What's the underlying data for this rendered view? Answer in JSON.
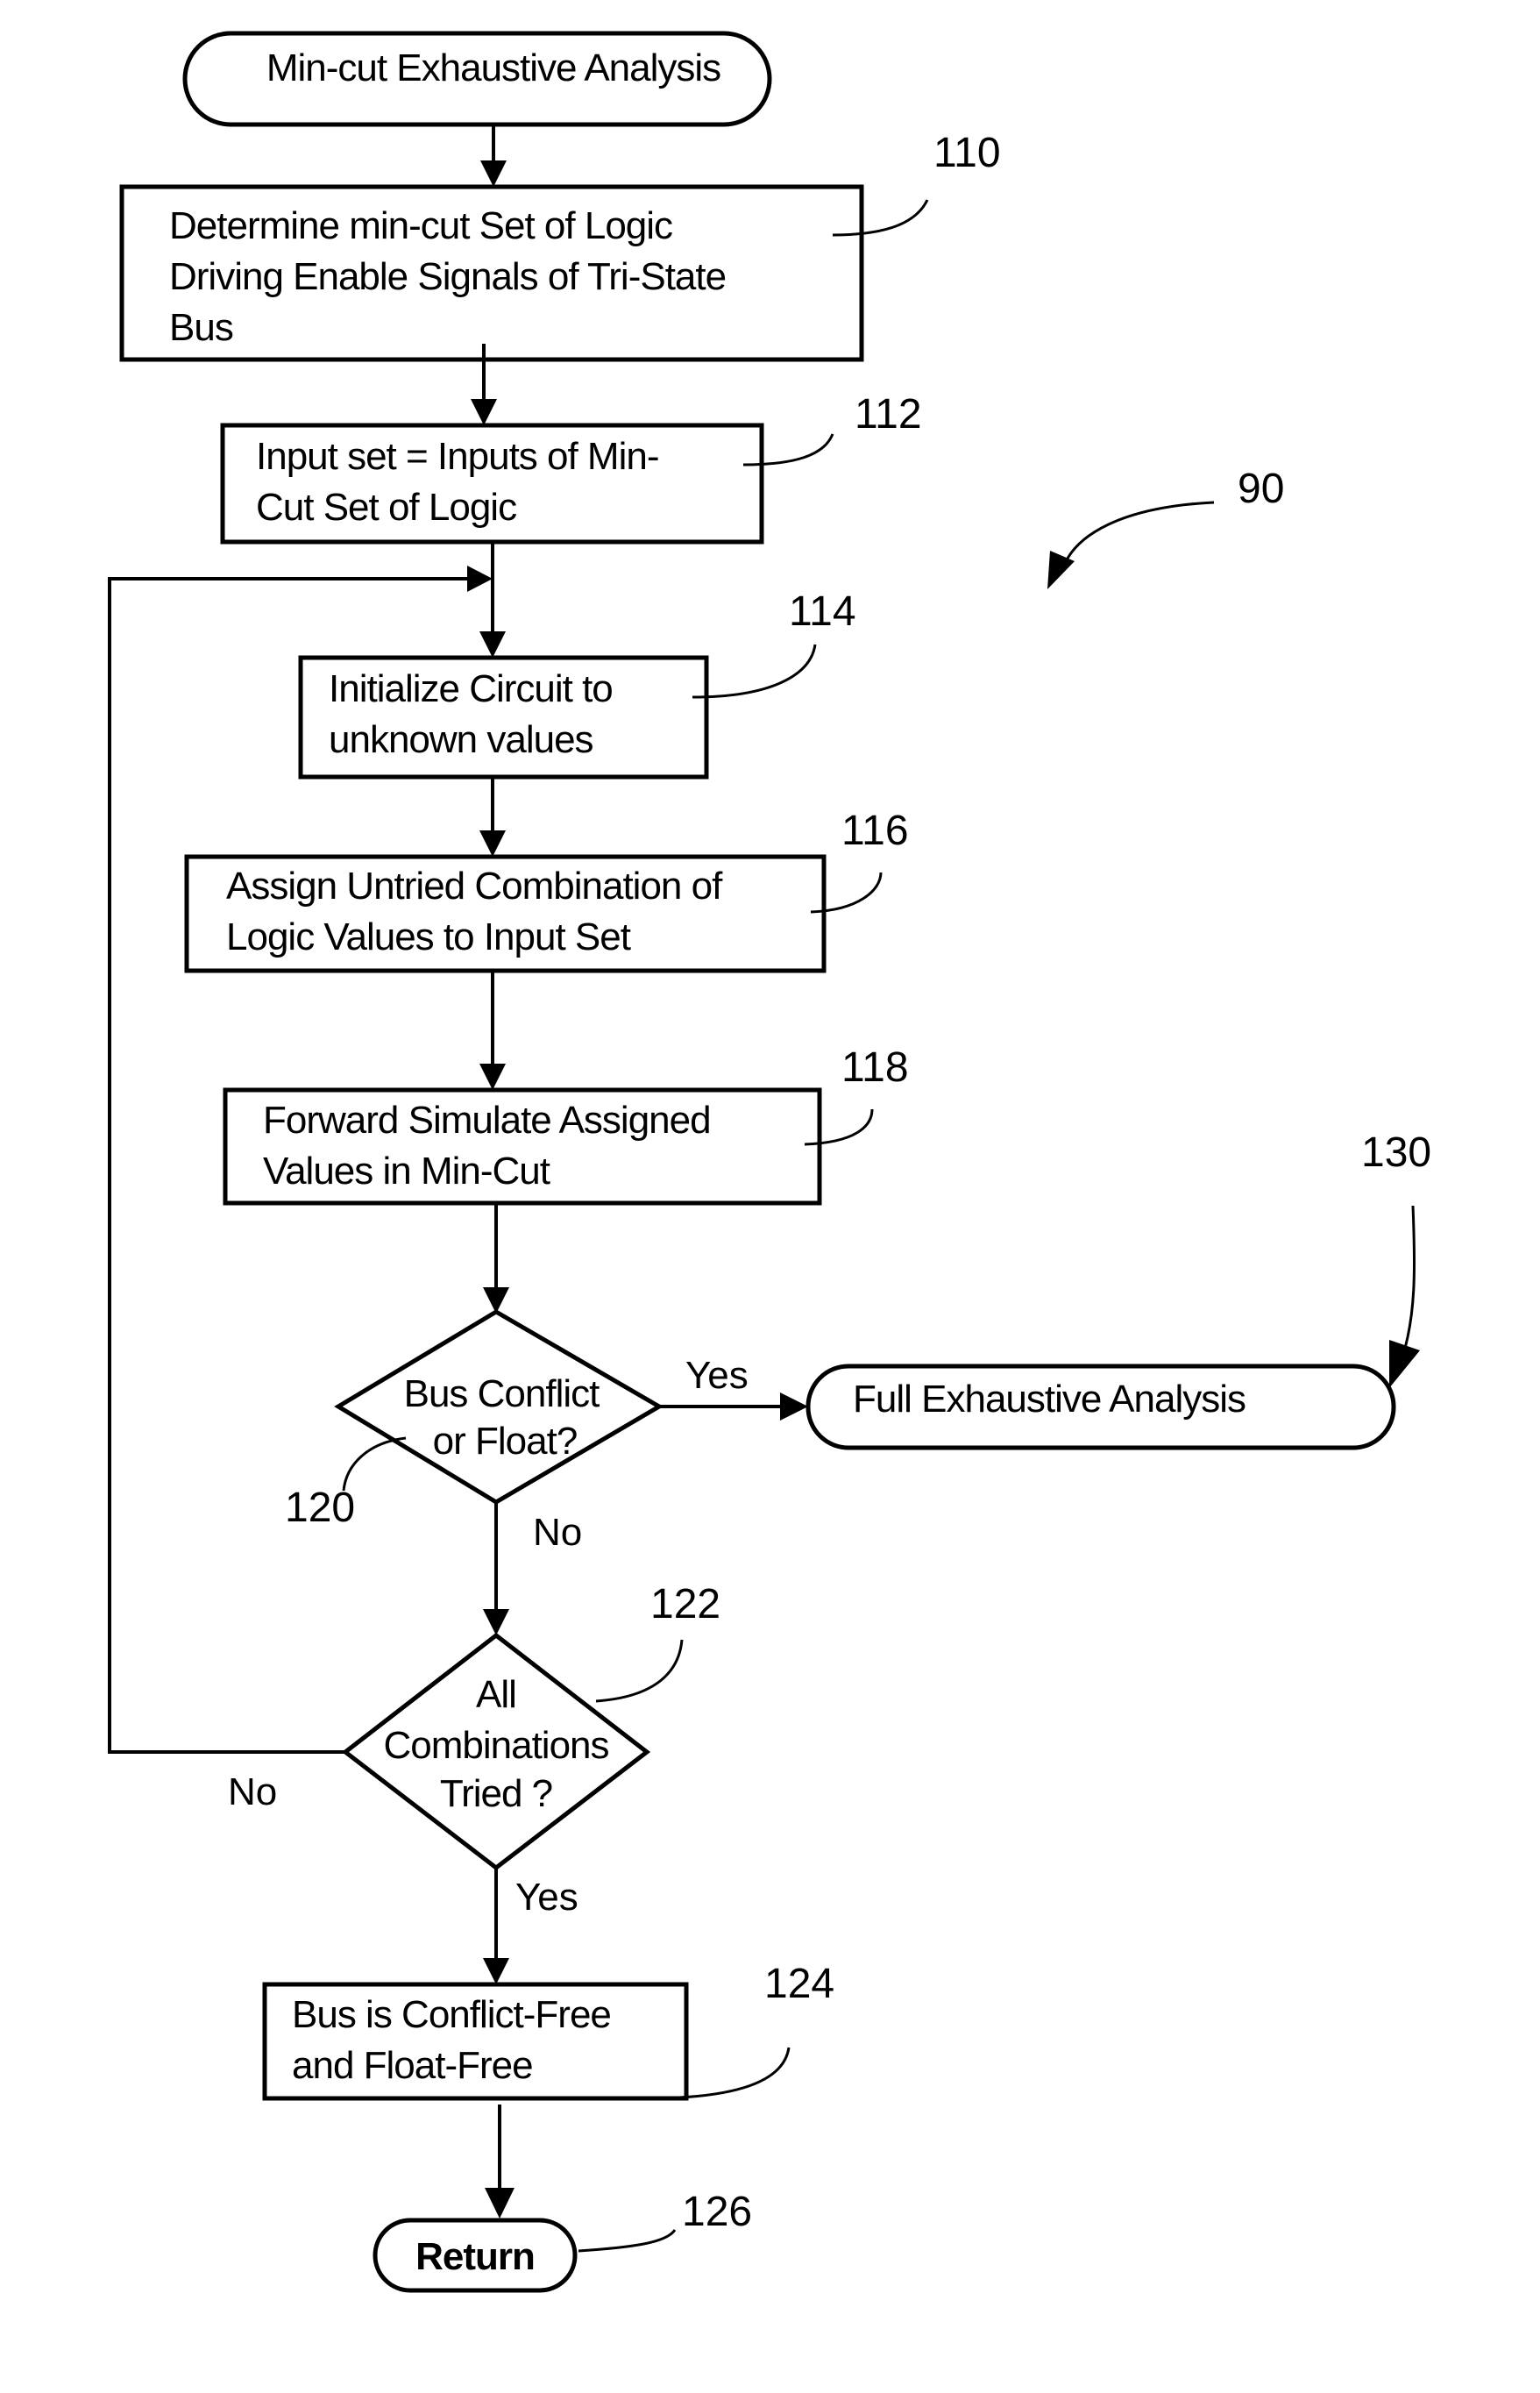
{
  "figure_ref": "90",
  "start": {
    "text": "Min-cut Exhaustive Analysis"
  },
  "steps": [
    {
      "ref": "110",
      "lines": [
        "Determine min-cut Set of Logic",
        "Driving Enable Signals of Tri-State",
        "Bus"
      ]
    },
    {
      "ref": "112",
      "lines": [
        "Input set = Inputs of Min-",
        "Cut Set of Logic"
      ]
    },
    {
      "ref": "114",
      "lines": [
        "Initialize Circuit to",
        "unknown values"
      ]
    },
    {
      "ref": "116",
      "lines": [
        "Assign Untried Combination of",
        "Logic Values to Input Set"
      ]
    },
    {
      "ref": "118",
      "lines": [
        "Forward Simulate Assigned",
        "Values in Min-Cut"
      ]
    },
    {
      "ref": "124",
      "lines": [
        "Bus is Conflict-Free",
        "and Float-Free"
      ]
    }
  ],
  "decisions": [
    {
      "ref": "120",
      "lines": [
        "Bus Conflict",
        "or Float?"
      ],
      "yes": "Yes",
      "no": "No"
    },
    {
      "ref": "122",
      "lines": [
        "All",
        "Combinations",
        "Tried ?"
      ],
      "yes": "Yes",
      "no": "No"
    }
  ],
  "full_analysis": {
    "ref": "130",
    "text": "Full Exhaustive Analysis"
  },
  "end": {
    "ref": "126",
    "text": "Return"
  }
}
